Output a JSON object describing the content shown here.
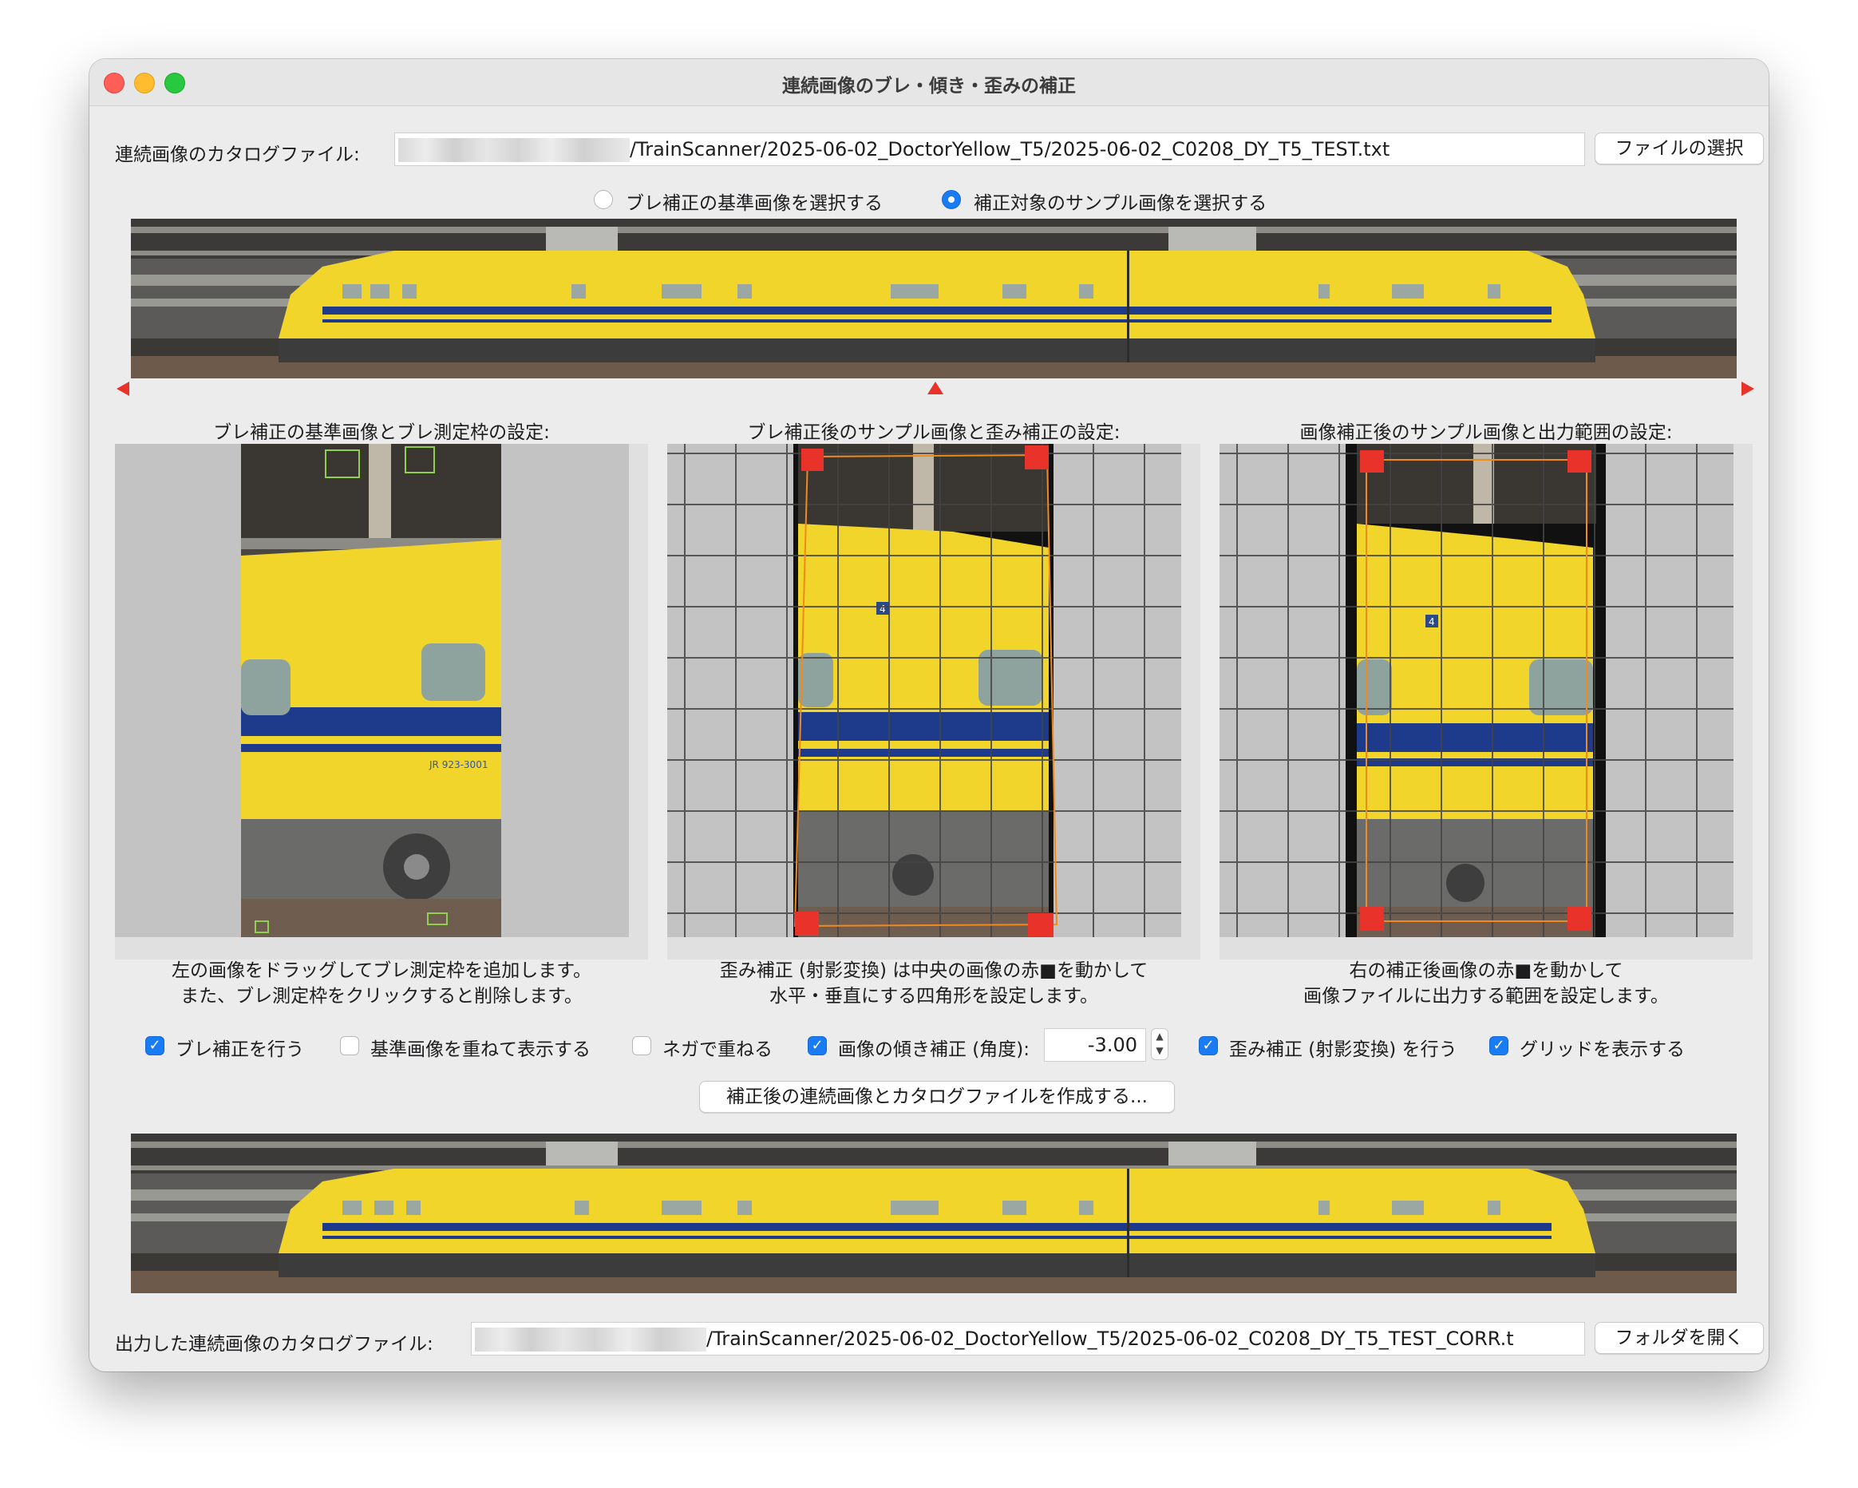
{
  "window": {
    "title": "連続画像のブレ・傾き・歪みの補正"
  },
  "catalog": {
    "label": "連続画像のカタログファイル:",
    "path": "/TrainScanner/2025-06-02_DoctorYellow_T5/2025-06-02_C0208_DY_T5_TEST.txt",
    "button": "ファイルの選択"
  },
  "mode": {
    "options": [
      "ブレ補正の基準画像を選択する",
      "補正対象のサンプル画像を選択する"
    ],
    "selected_index": 1
  },
  "panels": {
    "left": {
      "title": "ブレ補正の基準画像とブレ測定枠の設定:",
      "caption_line1": "左の画像をドラッグしてブレ測定枠を追加します。",
      "caption_line2": "また、ブレ測定枠をクリックすると削除します。"
    },
    "middle": {
      "title": "ブレ補正後のサンプル画像と歪み補正の設定:",
      "caption_line1": "歪み補正 (射影変換) は中央の画像の赤■を動かして",
      "caption_line2": "水平・垂直にする四角形を設定します。"
    },
    "right": {
      "title": "画像補正後のサンプル画像と出力範囲の設定:",
      "caption_line1": "右の補正後画像の赤■を動かして",
      "caption_line2": "画像ファイルに出力する範囲を設定します。"
    }
  },
  "train": {
    "car_number": "4",
    "jr_mark": "JR 923-3001"
  },
  "options": {
    "shake_correction": {
      "label": "ブレ補正を行う",
      "checked": true
    },
    "overlay_reference": {
      "label": "基準画像を重ねて表示する",
      "checked": false
    },
    "negative_overlay": {
      "label": "ネガで重ねる",
      "checked": false
    },
    "tilt_correction": {
      "label": "画像の傾き補正 (角度):",
      "checked": true,
      "value": "-3.00"
    },
    "distortion_correction": {
      "label": "歪み補正 (射影変換) を行う",
      "checked": true
    },
    "show_grid": {
      "label": "グリッドを表示する",
      "checked": true
    }
  },
  "create_button": "補正後の連続画像とカタログファイルを作成する...",
  "output": {
    "label": "出力した連続画像のカタログファイル:",
    "path": "/TrainScanner/2025-06-02_DoctorYellow_T5/2025-06-02_C0208_DY_T5_TEST_CORR.t",
    "button": "フォルダを開く"
  },
  "colors": {
    "accent": "#1a7cf5",
    "train_yellow": "#f2d52a",
    "train_stripe": "#1e3a8a",
    "marker_red": "#e8322a",
    "frame_green": "#8fd14f",
    "guide_orange": "#f08a1c"
  }
}
